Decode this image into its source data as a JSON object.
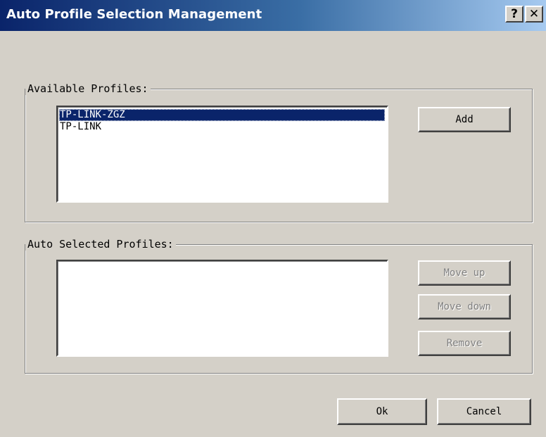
{
  "window": {
    "title": "Auto Profile Selection Management",
    "help_glyph": "?",
    "close_glyph": "✕"
  },
  "available": {
    "label": "Available Profiles:",
    "items": [
      {
        "label": "TP-LINK-ZGZ",
        "selected": true
      },
      {
        "label": "TP-LINK",
        "selected": false
      }
    ],
    "add_label": "Add"
  },
  "auto_selected": {
    "label": "Auto Selected Profiles:",
    "items": [],
    "move_up_label": "Move up",
    "move_down_label": "Move down",
    "remove_label": "Remove"
  },
  "footer": {
    "ok_label": "Ok",
    "cancel_label": "Cancel"
  },
  "colors": {
    "title_gradient_start": "#0a246a",
    "title_gradient_end": "#a6caf0",
    "dialog_face": "#d4d0c8",
    "selection": "#0a246a",
    "disabled_text": "#808080"
  }
}
